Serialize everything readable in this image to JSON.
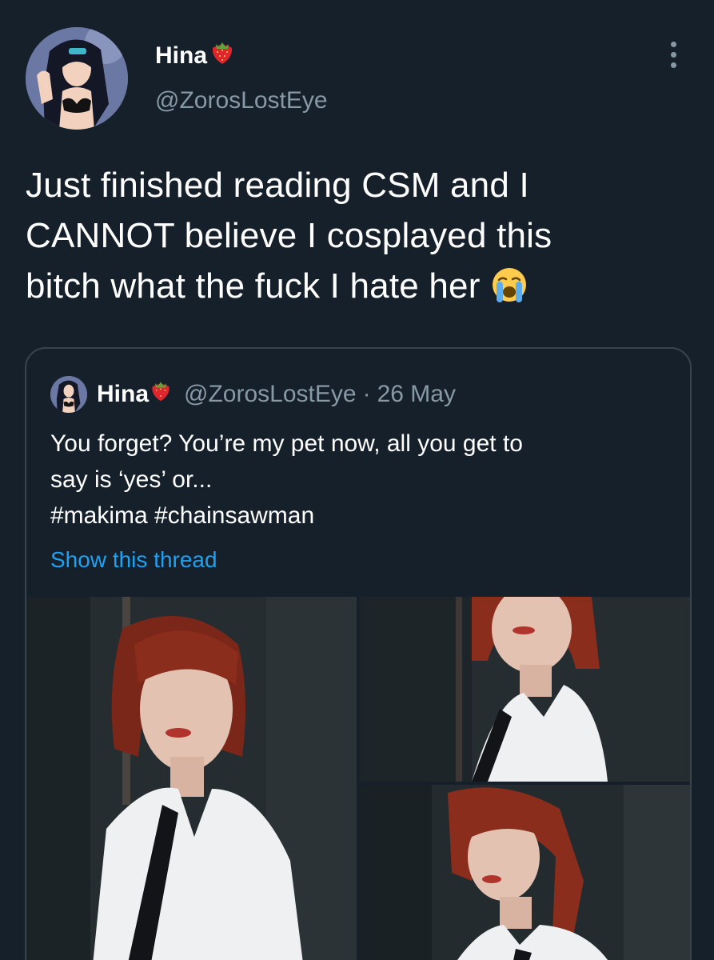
{
  "tweet": {
    "author": {
      "display_name": "Hina",
      "name_emoji_icon": "strawberry-emoji-icon",
      "handle": "@ZorosLostEye",
      "avatar_icon": "anime-character-avatar"
    },
    "more_icon": "vertical-ellipsis-icon",
    "text_lines": [
      "Just finished reading CSM and I",
      "CANNOT believe I cosplayed this",
      "bitch what the fuck I hate her"
    ],
    "text_emoji_icon": "loudly-crying-face-emoji-icon",
    "quoted_tweet": {
      "display_name": "Hina",
      "handle": "@ZorosLostEye",
      "separator": "·",
      "date": "26 May",
      "text_lines": [
        "You forget? You’re my pet now, all you get to",
        "say is ‘yes’ or...",
        "#makima #chainsawman"
      ],
      "show_thread_label": "Show this thread",
      "media": [
        {
          "icon": "cosplay-photo-1"
        },
        {
          "icon": "cosplay-photo-2"
        },
        {
          "icon": "cosplay-photo-3"
        }
      ]
    }
  },
  "colors": {
    "background": "#15202b",
    "secondary_text": "#8899a6",
    "link": "#1da1f2",
    "border": "#38444d"
  }
}
